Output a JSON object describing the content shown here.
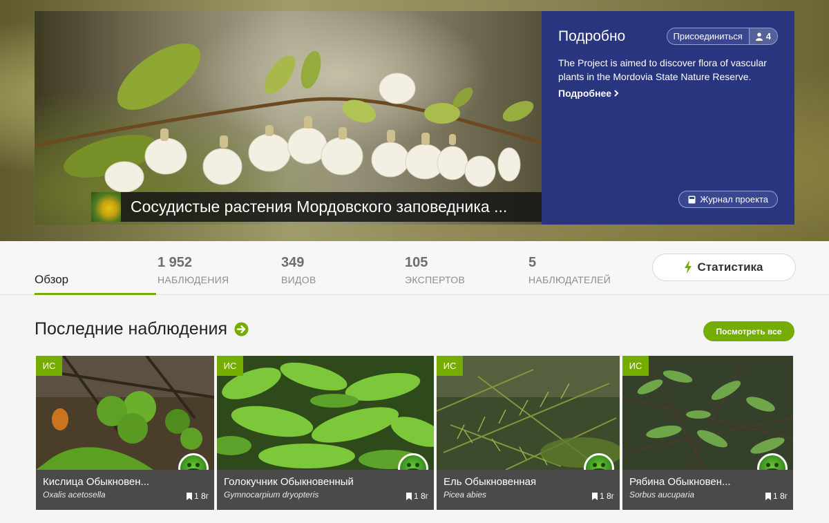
{
  "project": {
    "title": "Сосудистые растения Мордовского заповедника ...",
    "panel_title": "Подробно",
    "join_label": "Присоединиться",
    "members_count": "4",
    "description": "The Project is aimed to discover flora of vascular plants in the Mordovia State Nature Reserve.",
    "more_label": "Подробнее",
    "journal_label": "Журнал проекта"
  },
  "stats": {
    "overview_label": "Обзор",
    "items": [
      {
        "value": "1 952",
        "label": "Наблюдения"
      },
      {
        "value": "349",
        "label": "Видов"
      },
      {
        "value": "105",
        "label": "Экспертов"
      },
      {
        "value": "5",
        "label": "Наблюдателей"
      }
    ],
    "stats_button_label": "Статистика"
  },
  "recent": {
    "title": "Последние наблюдения",
    "view_all_label": "Посмотреть все",
    "cards": [
      {
        "grade": "ИС",
        "name": "Кислица Обыкновен...",
        "sci": "Oxalis acetosella",
        "age": "1 8г"
      },
      {
        "grade": "ИС",
        "name": "Голокучник Обыкновенный",
        "sci": "Gymnocarpium dryopteris",
        "age": "1 8г"
      },
      {
        "grade": "ИС",
        "name": "Ель Обыкновенная",
        "sci": "Picea abies",
        "age": "1 8г"
      },
      {
        "grade": "ИС",
        "name": "Рябина Обыкновен...",
        "sci": "Sorbus aucuparia",
        "age": "1 8г"
      }
    ]
  },
  "colors": {
    "accent_green": "#74ac00",
    "panel_blue": "#29357f",
    "card_info_bg": "#4a4a4a"
  }
}
